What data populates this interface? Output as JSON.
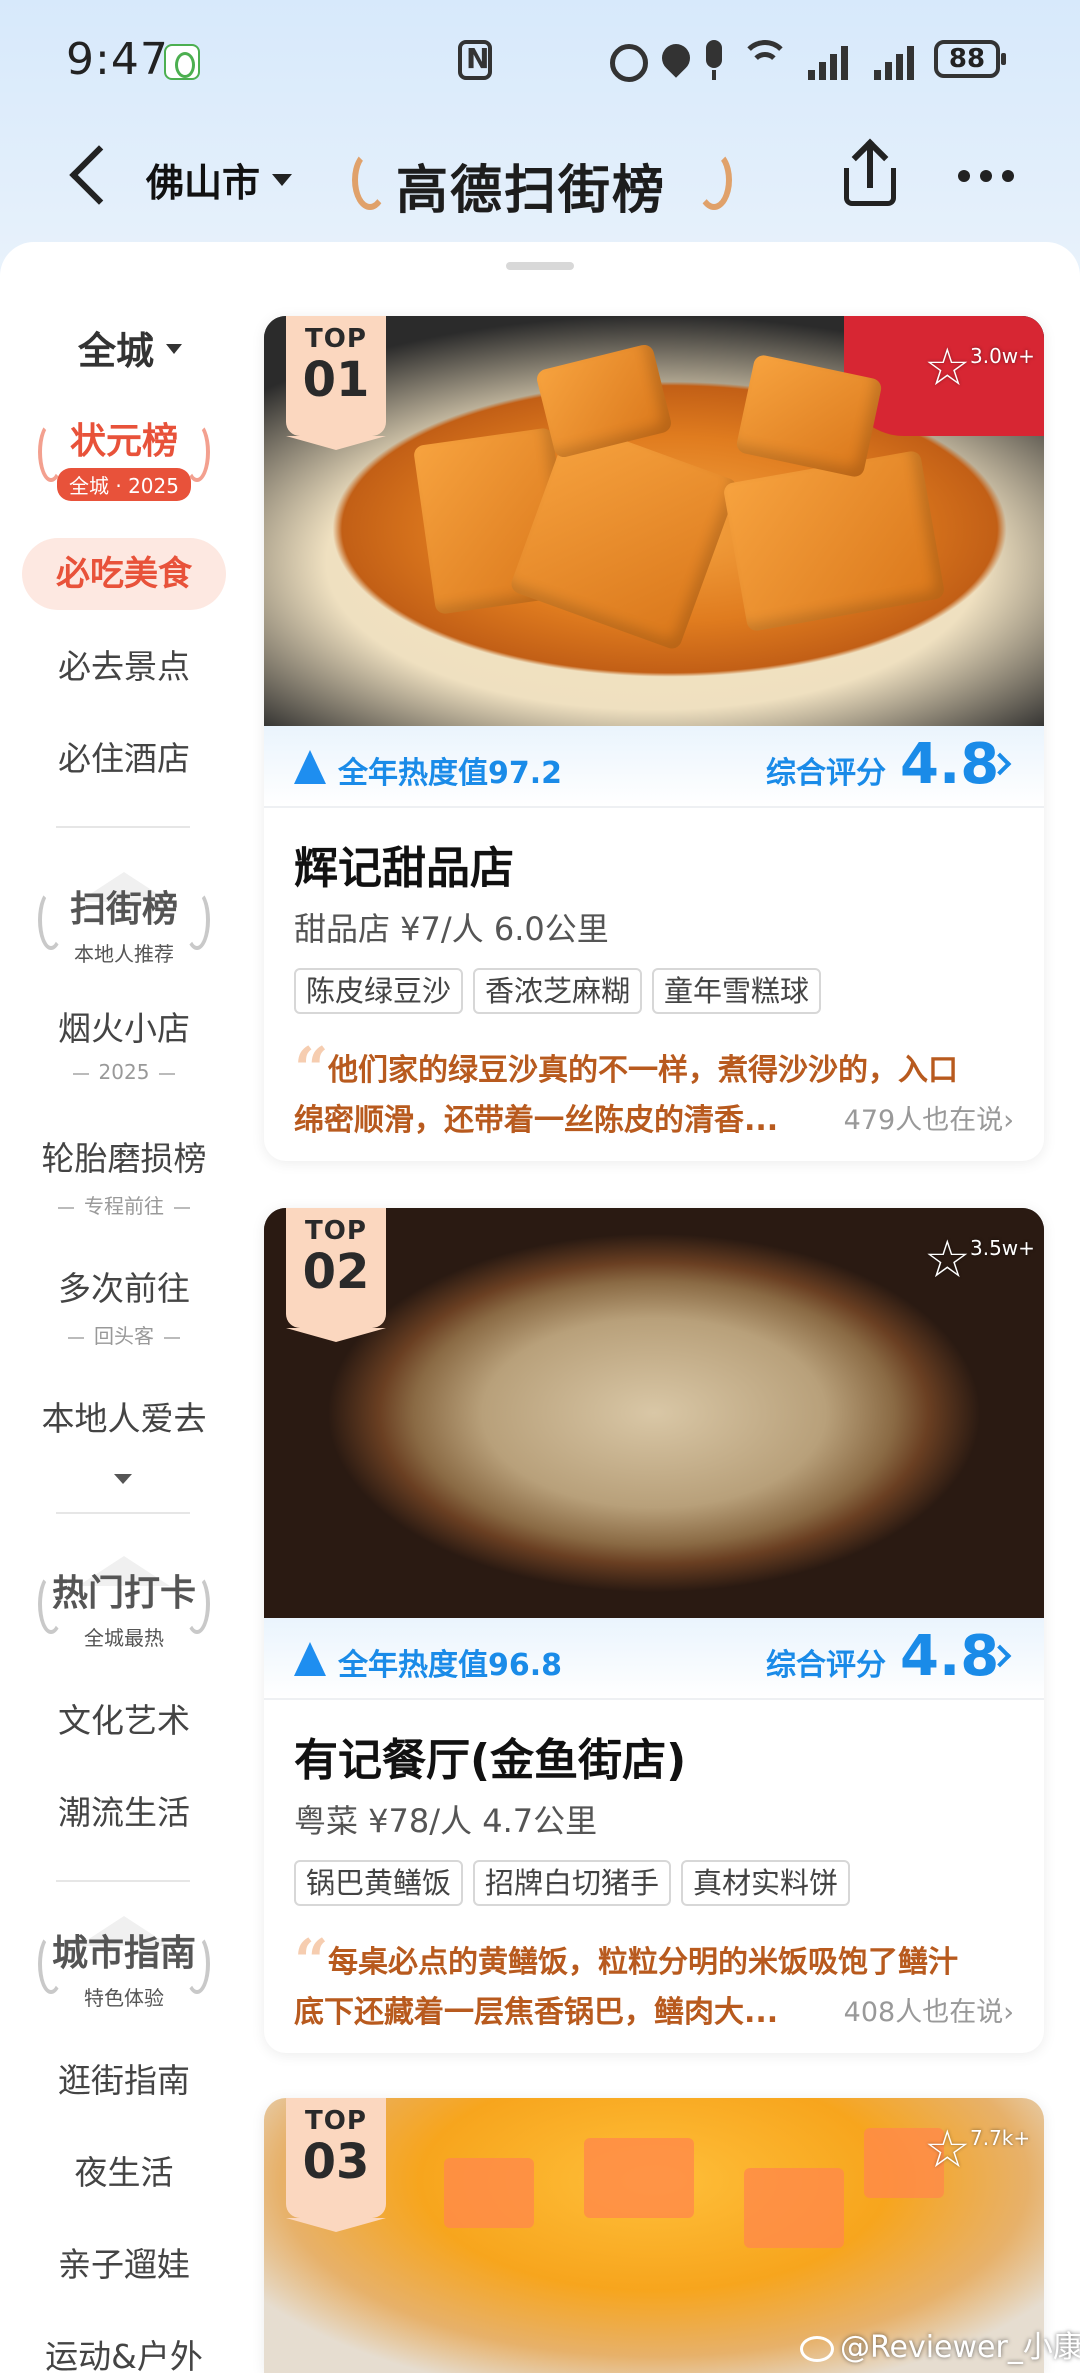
{
  "status_bar": {
    "time": "9:47",
    "battery": "88"
  },
  "header": {
    "city": "佛山市",
    "brand_title": "高德扫街榜",
    "icons": [
      "back-arrow-icon",
      "share-icon",
      "more-icon"
    ]
  },
  "sidebar": {
    "scope": "全城",
    "group_1": {
      "title": "状元榜",
      "sub": "全城 · 2025"
    },
    "active_item": "必吃美食",
    "items_1": [
      "必去景点",
      "必住酒店"
    ],
    "group_2": {
      "title": "扫街榜",
      "sub": "本地人推荐"
    },
    "list_2": [
      {
        "label": "烟火小店",
        "sub": "2025"
      },
      {
        "label": "轮胎磨损榜",
        "sub": "专程前往"
      },
      {
        "label": "多次前往",
        "sub": "回头客"
      },
      {
        "label": "本地人爱去",
        "sub": ""
      }
    ],
    "group_3": {
      "title": "热门打卡",
      "sub": "全城最热"
    },
    "items_3": [
      "文化艺术",
      "潮流生活"
    ],
    "group_4": {
      "title": "城市指南",
      "sub": "特色体验"
    },
    "items_4": [
      "逛街指南",
      "夜生活",
      "亲子遛娃",
      "运动&户外"
    ]
  },
  "cards": [
    {
      "rank_top": "TOP",
      "rank_num": "01",
      "fav_count": "3.0w+",
      "heat": "全年热度值97.2",
      "score_label": "综合评分",
      "score": "4.8",
      "name": "辉记甜品店",
      "meta": "甜品店 ¥7/人 6.0公里",
      "tags": [
        "陈皮绿豆沙",
        "香浓芝麻糊",
        "童年雪糕球"
      ],
      "quote_line1": "他们家的绿豆沙真的不一样，煮得沙沙的，入口",
      "quote_line2": "绵密顺滑，还带着一丝陈皮的清香...",
      "saying": "479人也在说›"
    },
    {
      "rank_top": "TOP",
      "rank_num": "02",
      "fav_count": "3.5w+",
      "heat": "全年热度值96.8",
      "score_label": "综合评分",
      "score": "4.8",
      "name": "有记餐厅(金鱼街店)",
      "meta": "粤菜 ¥78/人 4.7公里",
      "tags": [
        "锅巴黄鳝饭",
        "招牌白切猪手",
        "真材实料饼"
      ],
      "quote_line1": "每桌必点的黄鳝饭，粒粒分明的米饭吸饱了鳝汁",
      "quote_line2": "底下还藏着一层焦香锅巴，鳝肉大...",
      "saying": "408人也在说›"
    },
    {
      "rank_top": "TOP",
      "rank_num": "03",
      "fav_count": "7.7k+"
    }
  ],
  "watermark": "@Reviewer_小康"
}
